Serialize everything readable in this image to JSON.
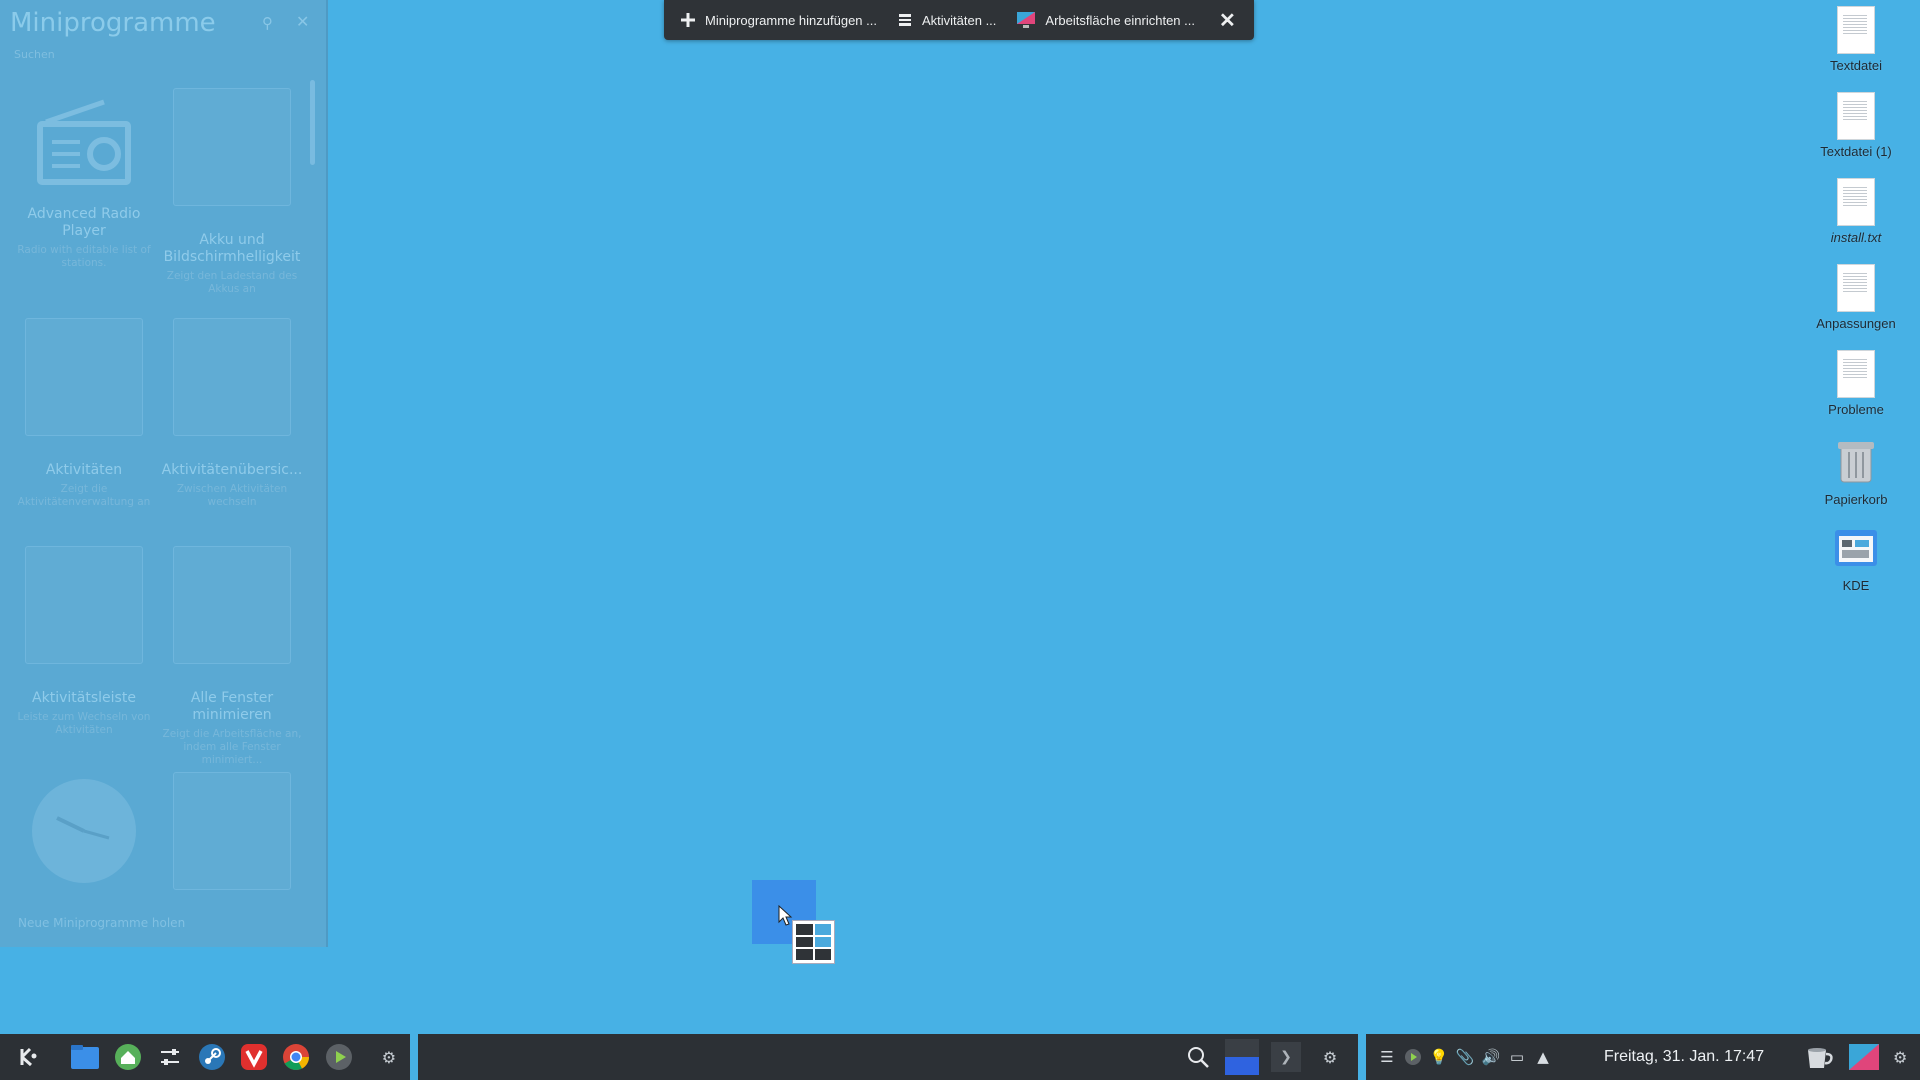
{
  "explorer": {
    "title": "Miniprogramme",
    "search_placeholder": "Suchen",
    "footer": "Neue Miniprogramme holen",
    "widgets": [
      {
        "name": "Advanced Radio Player",
        "desc": "Radio with editable list of stations."
      },
      {
        "name": "Akku und Bildschirmhelligkeit",
        "desc": "Zeigt den Ladestand des Akkus an"
      },
      {
        "name": "Aktivitäten",
        "desc": "Zeigt die Aktivitätenverwaltung an"
      },
      {
        "name": "Aktivitätenübersic...",
        "desc": "Zwischen Aktivitäten wechseln"
      },
      {
        "name": "Aktivitätsleiste",
        "desc": "Leiste zum Wechseln von Aktivitäten"
      },
      {
        "name": "Alle Fenster minimieren",
        "desc": "Zeigt die Arbeitsfläche an, indem alle Fenster minimiert..."
      }
    ]
  },
  "toolbar": {
    "add_widgets": "Miniprogramme hinzufügen ...",
    "activities": "Aktivitäten ...",
    "configure_desktop": "Arbeitsfläche einrichten ..."
  },
  "desktop_icons": [
    {
      "label": "Textdatei"
    },
    {
      "label": "Textdatei (1)"
    },
    {
      "label": "install.txt"
    },
    {
      "label": "Anpassungen"
    },
    {
      "label": "Probleme"
    },
    {
      "label": "Papierkorb"
    },
    {
      "label": "KDE"
    }
  ],
  "taskbar": {
    "clock": "Freitag, 31. Jan.  17:47",
    "colors": {
      "panel": "#2c3035",
      "desktop": "#47b1e5",
      "accent": "#3b8fe8"
    }
  }
}
